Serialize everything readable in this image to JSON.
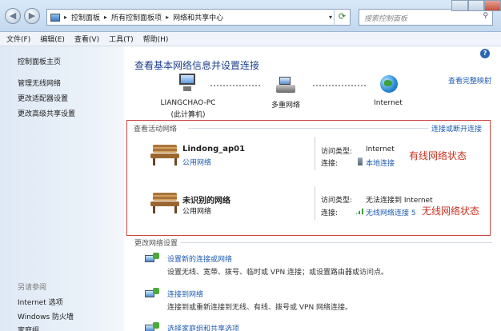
{
  "address": {
    "crumbs": [
      "控制面板",
      "所有控制面板项",
      "网络和共享中心"
    ],
    "search_placeholder": "搜索控制面板"
  },
  "menu": [
    "文件(F)",
    "编辑(E)",
    "查看(V)",
    "工具(T)",
    "帮助(H)"
  ],
  "sidebar": {
    "links": [
      "控制面板主页",
      "管理无线网络",
      "更改适配器设置",
      "更改高级共享设置"
    ],
    "see_also_title": "另请参阅",
    "see_also": [
      "Internet 选项",
      "Windows 防火墙",
      "家庭组"
    ]
  },
  "main": {
    "title": "查看基本网络信息并设置连接",
    "full_map": "查看完整映射",
    "nodes": {
      "pc": "LIANGCHAO-PC",
      "pc_sub": "(此计算机)",
      "multi": "多重网络",
      "internet": "Internet"
    },
    "active": {
      "title": "查看活动网络",
      "connect_link": "连接或断开连接",
      "networks": [
        {
          "name": "Lindong_ap01",
          "type": "公用网络",
          "access_key": "访问类型:",
          "access_value": "Internet",
          "conn_key": "连接:",
          "conn_value": "本地连接",
          "annotation": "有线网络状态"
        },
        {
          "name": "未识别的网络",
          "type": "公用网络",
          "access_key": "访问类型:",
          "access_value": "无法连接到 Internet",
          "conn_key": "连接:",
          "conn_value": "无线网络连接 5",
          "annotation": "无线网络状态"
        }
      ]
    },
    "change": {
      "title": "更改网络设置",
      "tasks": [
        {
          "link": "设置新的连接或网络",
          "desc": "设置无线、宽带、拨号、临时或 VPN 连接；或设置路由器或访问点。"
        },
        {
          "link": "连接到网络",
          "desc": "连接到或重新连接到无线、有线、拨号或 VPN 网络连接。"
        },
        {
          "link": "选择家庭组和共享选项",
          "desc": ""
        }
      ]
    }
  }
}
